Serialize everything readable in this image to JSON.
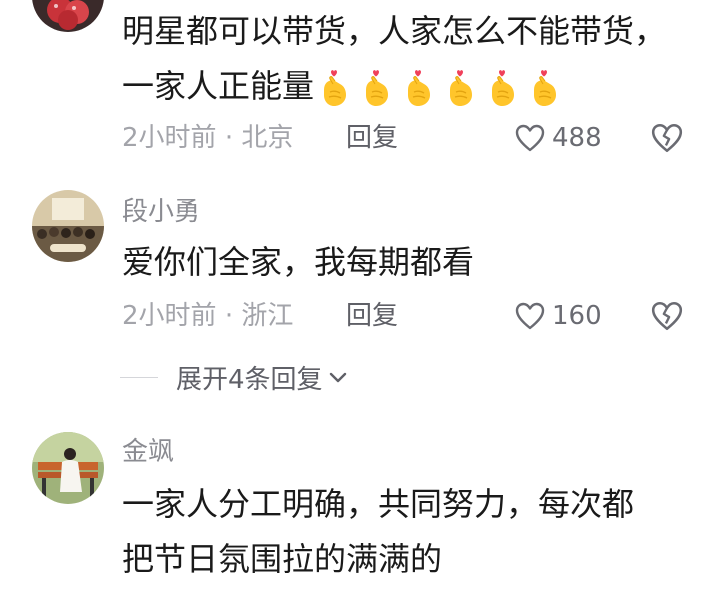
{
  "comments": [
    {
      "text_line1": "明星都可以带货，人家怎么不能带货，",
      "text_line2": "一家人正能量",
      "emoji_icon": "finger-heart-emoji",
      "emoji_count": 6,
      "time": "2小时前",
      "location": "北京",
      "reply_label": "回复",
      "likes": "488"
    },
    {
      "username": "段小勇",
      "text": "爱你们全家，我每期都看",
      "time": "2小时前",
      "location": "浙江",
      "reply_label": "回复",
      "likes": "160"
    },
    {
      "username": "金飒",
      "text_line1": "一家人分工明确，共同努力，每次都",
      "text_line2": "把节日氛围拉的满满的"
    }
  ],
  "expand_replies": {
    "label": "展开4条回复"
  },
  "colors": {
    "meta": "#a3a4aa",
    "username": "#8a8b91",
    "text": "#1a1a1a"
  }
}
